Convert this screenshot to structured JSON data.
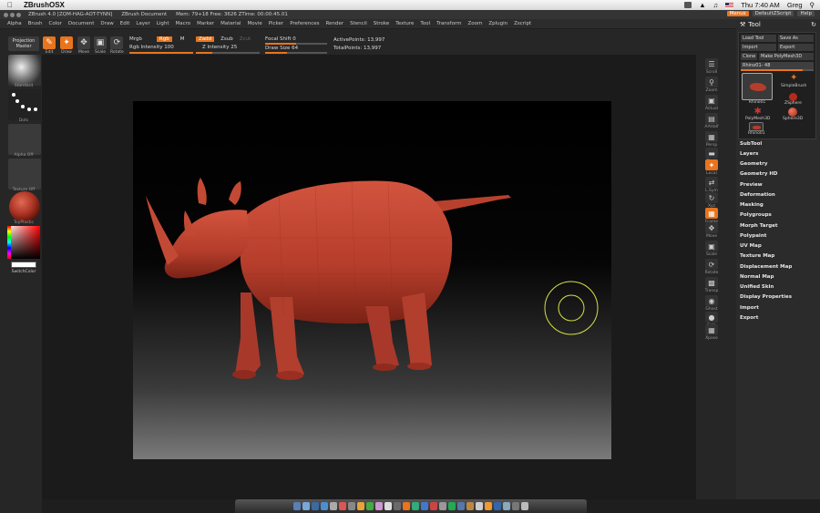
{
  "macbar": {
    "app_name": "ZBrushOSX",
    "clock": "Thu 7:40 AM",
    "user": "Greg"
  },
  "titlebar": {
    "version": "ZBrush 4.0 [ZQM-HAG-AOT-TYNN]",
    "document": "ZBrush Document",
    "stats": "Mem: 79+18 Free: 3626 ZTime: 00:00:45.01",
    "menus_btn": "Menus",
    "script_btn": "DefaultZScript",
    "help_btn": "Help"
  },
  "menubar": {
    "items": [
      "Alpha",
      "Brush",
      "Color",
      "Document",
      "Draw",
      "Edit",
      "Layer",
      "Light",
      "Macro",
      "Marker",
      "Material",
      "Movie",
      "Picker",
      "Preferences",
      "Render",
      "Stencil",
      "Stroke",
      "Texture",
      "Tool",
      "Transform",
      "Zoom",
      "Zplugin",
      "Zscript"
    ]
  },
  "shelf": {
    "projection": "Projection Master",
    "buttons": {
      "edit": "Edit",
      "draw": "Draw",
      "move": "Move",
      "scale": "Scale",
      "rotate": "Rotate"
    },
    "mrgb": "Mrgb",
    "rgb_tag": "Rgb",
    "m_label": "M",
    "rgb_intensity": "Rgb Intensity 100",
    "zadd": "Zadd",
    "zsub": "Zsub",
    "zcut": "Zcut",
    "z_intensity": "Z Intensity 25",
    "focal_shift": "Focal Shift 0",
    "draw_size": "Draw Size 64",
    "active_points": "ActivePoints: 13,997",
    "total_points": "TotalPoints: 13,997",
    "rgb_intensity_level": 1.0,
    "z_intensity_level": 0.25,
    "draw_size_level": 0.35
  },
  "lefttray": {
    "labels": [
      "Standard",
      "Dots",
      "Alpha Off",
      "Texture Off",
      "ToyPlastic",
      "SwitchColor"
    ],
    "active_color": "#9a2a1e"
  },
  "rightshelf": {
    "buttons": [
      "Scroll",
      "Zoom",
      "Actual",
      "AAHalf",
      "Persp",
      "Floor",
      "Local",
      "L.Sym",
      "Xyz",
      "Frame",
      "Move",
      "Scale",
      "Rotate",
      "Transp",
      "Ghost",
      "Solo",
      "Xpose"
    ]
  },
  "toolpanel": {
    "title": "Tool",
    "load": "Load Tool",
    "save_as": "Save As",
    "import": "Import",
    "export": "Export",
    "clone": "Clone",
    "make_polymesh": "Make PolyMesh3D",
    "rhino_slider": "Rhino01- 48",
    "thumbs": [
      "Rhino01",
      "SimpleBrush",
      "ZSphere",
      "PolyMesh3D",
      "Sphere3D",
      "Rhino01"
    ],
    "sections": [
      "SubTool",
      "Layers",
      "Geometry",
      "Geometry HD",
      "Preview",
      "Deformation",
      "Masking",
      "Polygroups",
      "Morph Target",
      "Polypaint",
      "UV Map",
      "Texture Map",
      "Displacement Map",
      "Normal Map",
      "Unified Skin",
      "Display Properties",
      "Import",
      "Export"
    ]
  },
  "colors": {
    "accent": "#e8741e",
    "clay": "#c4432f",
    "brush_ring": "#d6e04a"
  }
}
